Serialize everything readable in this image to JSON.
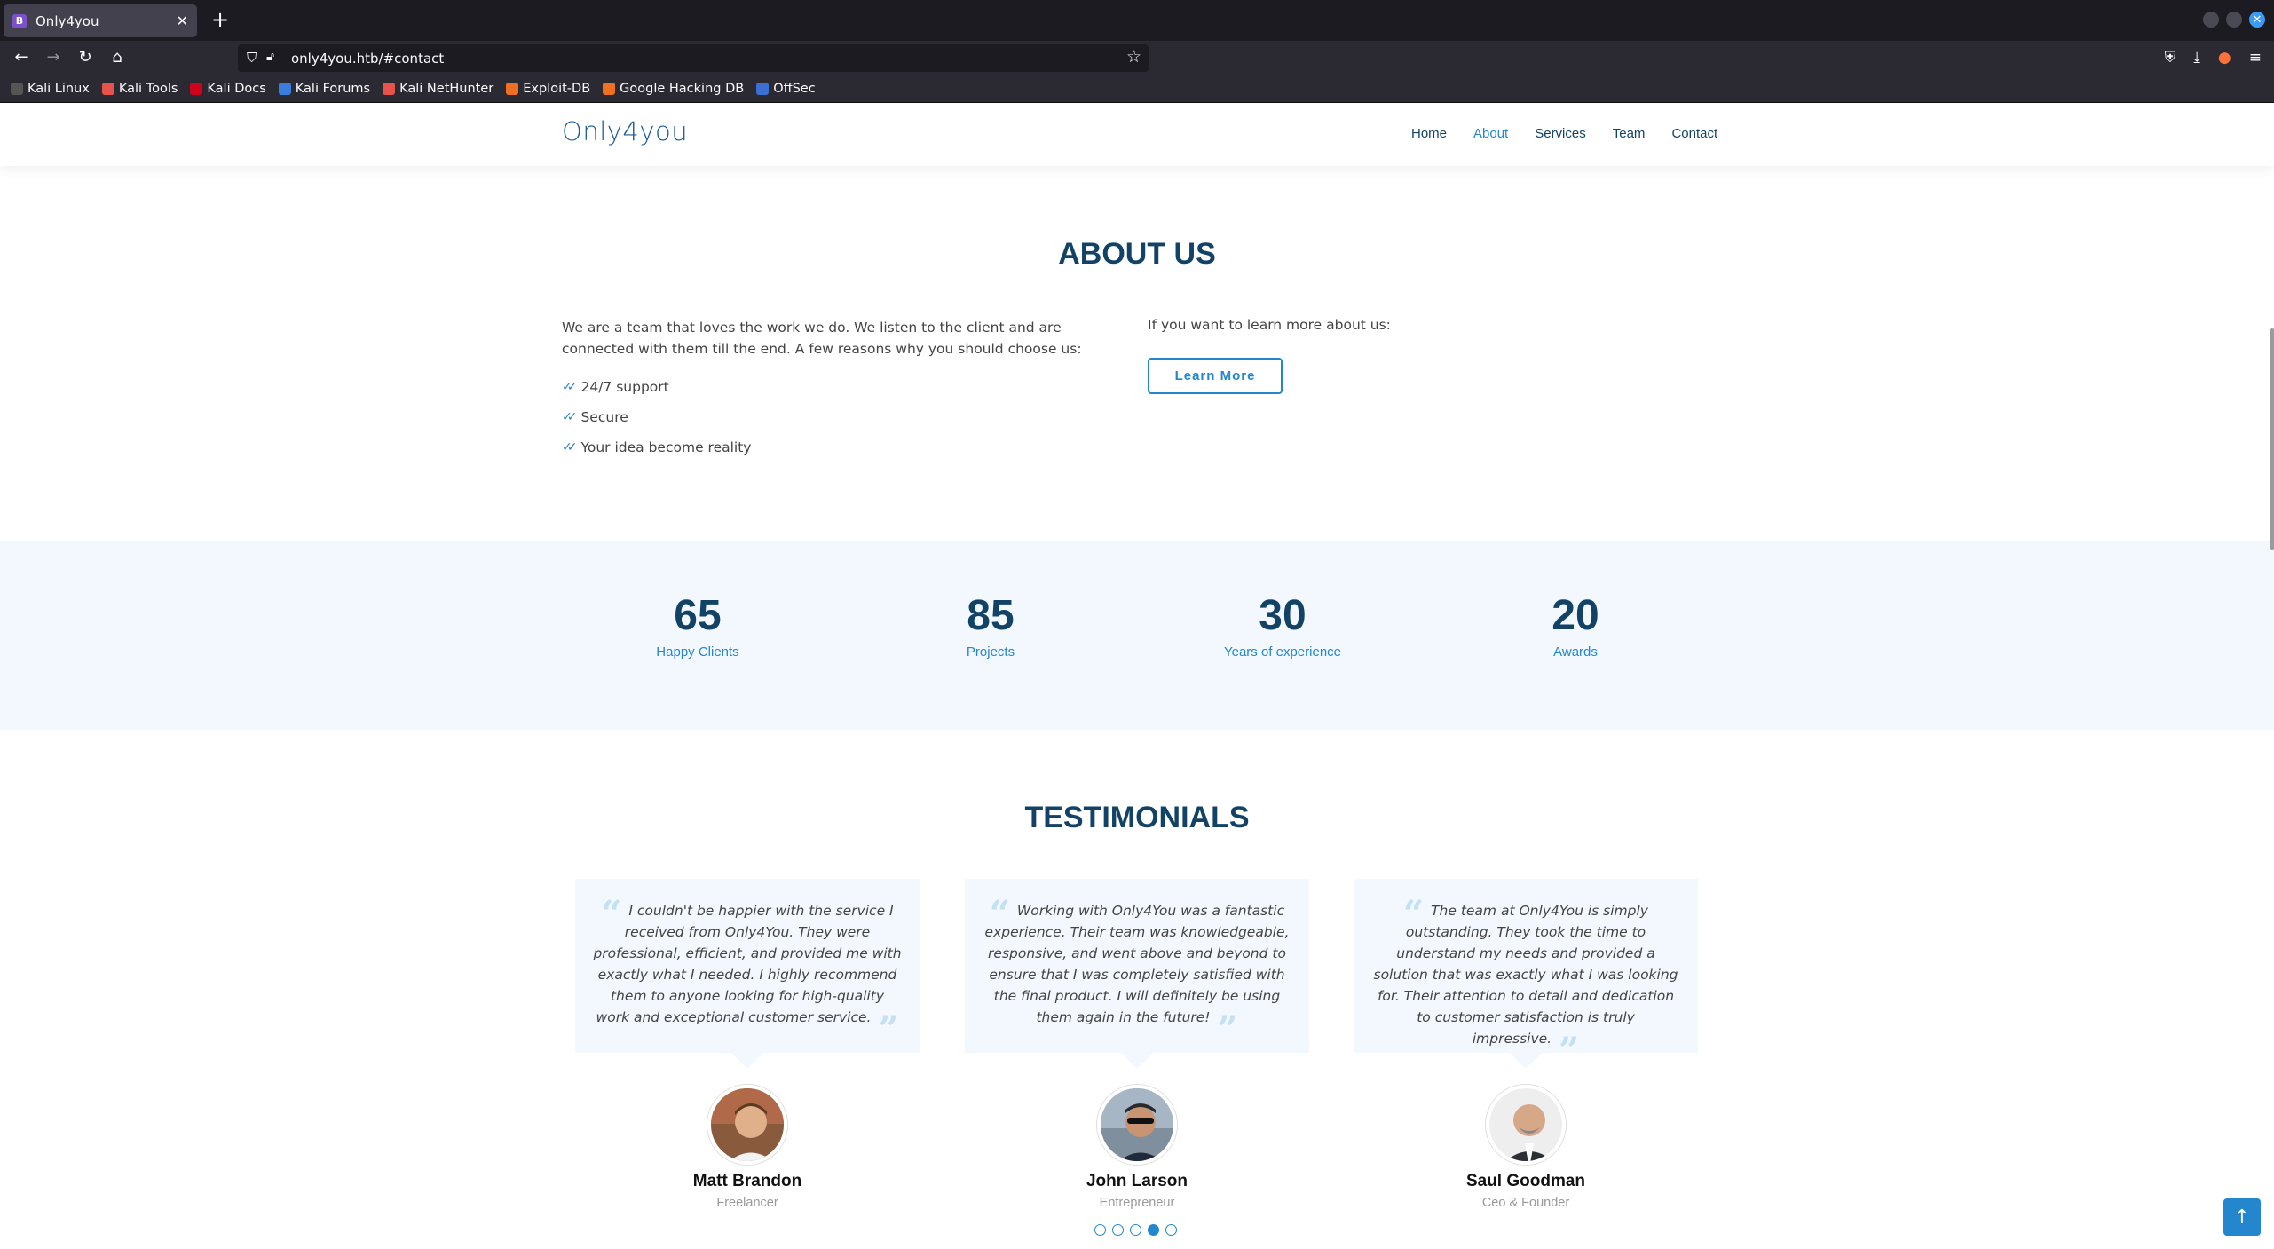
{
  "browser": {
    "tab_title": "Only4you",
    "tab_favicon": "B",
    "new_tab_label": "+",
    "url": "only4you.htb/#contact",
    "bookmarks": [
      {
        "label": "Kali Linux",
        "color": "#555555"
      },
      {
        "label": "Kali Tools",
        "color": "#e5534b"
      },
      {
        "label": "Kali Docs",
        "color": "#d0021b"
      },
      {
        "label": "Kali Forums",
        "color": "#3b7ddd"
      },
      {
        "label": "Kali NetHunter",
        "color": "#e5534b"
      },
      {
        "label": "Exploit-DB",
        "color": "#f06f20"
      },
      {
        "label": "Google Hacking DB",
        "color": "#f06f20"
      },
      {
        "label": "OffSec",
        "color": "#3b6fd4"
      }
    ],
    "icons": {
      "back": "back-arrow-icon",
      "forward": "forward-arrow-icon",
      "reload": "reload-icon",
      "home": "home-icon",
      "shield": "shield-icon",
      "lock": "lock-icon",
      "star": "bookmark-star-icon",
      "pocket": "pocket-icon",
      "download": "download-icon",
      "account": "firefox-account-icon",
      "menu": "hamburger-menu-icon"
    }
  },
  "site": {
    "logo": "Only4you",
    "nav": [
      {
        "label": "Home",
        "active": false
      },
      {
        "label": "About",
        "active": true
      },
      {
        "label": "Services",
        "active": false
      },
      {
        "label": "Team",
        "active": false
      },
      {
        "label": "Contact",
        "active": false
      }
    ],
    "accent_color": "#2487ce",
    "heading_color": "#124265"
  },
  "about": {
    "title": "ABOUT US",
    "intro": "We are a team that loves the work we do. We listen to the client and are connected with them till the end. A few reasons why you should choose us:",
    "reasons": [
      "24/7 support",
      "Secure",
      "Your idea become reality"
    ],
    "learn_prompt": "If you want to learn more about us:",
    "learn_button": "Learn More"
  },
  "counts": [
    {
      "value": "65",
      "label": "Happy Clients"
    },
    {
      "value": "85",
      "label": "Projects"
    },
    {
      "value": "30",
      "label": "Years of experience"
    },
    {
      "value": "20",
      "label": "Awards"
    }
  ],
  "testimonials": {
    "title": "TESTIMONIALS",
    "items": [
      {
        "text": "I couldn't be happier with the service I received from Only4You. They were professional, efficient, and provided me with exactly what I needed. I highly recommend them to anyone looking for high-quality work and exceptional customer service.",
        "name": "Matt Brandon",
        "role": "Freelancer"
      },
      {
        "text": "Working with Only4You was a fantastic experience. Their team was knowledgeable, responsive, and went above and beyond to ensure that I was completely satisfied with the final product. I will definitely be using them again in the future!",
        "name": "John Larson",
        "role": "Entrepreneur"
      },
      {
        "text": "The team at Only4You is simply outstanding. They took the time to understand my needs and provided a solution that was exactly what I was looking for. Their attention to detail and dedication to customer satisfaction is truly impressive.",
        "name": "Saul Goodman",
        "role": "Ceo & Founder"
      }
    ],
    "pagination_count": 5,
    "pagination_active": 4
  }
}
